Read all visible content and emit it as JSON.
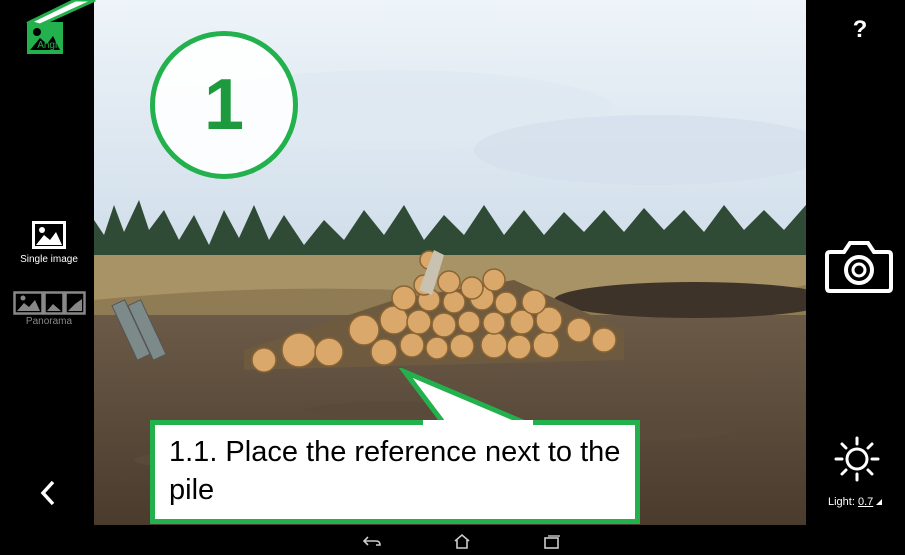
{
  "left_bar": {
    "angle_label": "Angle",
    "single_image_label": "Single image",
    "panorama_label": "Panorama",
    "back_icon": "chevron-left-icon"
  },
  "right_bar": {
    "help_label": "?",
    "camera_icon": "camera-icon",
    "light_label": "Light:",
    "light_value": "0.7"
  },
  "overlay": {
    "step_number": "1",
    "callout_text": "1.1. Place the reference next to the pile"
  },
  "nav": {
    "icons": [
      "back-icon",
      "home-icon",
      "recent-apps-icon"
    ]
  },
  "colors": {
    "accent": "#22b14c"
  }
}
